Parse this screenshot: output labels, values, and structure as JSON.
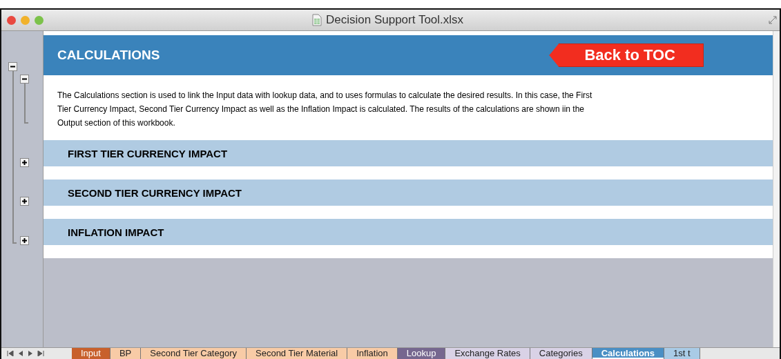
{
  "window": {
    "title": "Decision Support Tool.xlsx"
  },
  "header": {
    "title": "CALCULATIONS",
    "button": "Back to TOC"
  },
  "description": "The Calculations section is used to link the Input data with lookup data, and to uses formulas to calculate the desired results. In this case, the First Tier Currency Impact, Second Tier Currency Impact as well as the Inflation Impact is calculated. The results of the calculations are shown iin the Output section of this workbook.",
  "outline": {
    "expanded": true,
    "groups": [
      {
        "expanded": true
      },
      {
        "expanded": false
      },
      {
        "expanded": false
      },
      {
        "expanded": false
      }
    ]
  },
  "sections": [
    {
      "title": "FIRST TIER CURRENCY IMPACT"
    },
    {
      "title": "SECOND TIER CURRENCY IMPACT"
    },
    {
      "title": "INFLATION IMPACT"
    }
  ],
  "sheet_tabs": [
    {
      "label": "Input",
      "color": "#c8602c",
      "selected": false
    },
    {
      "label": "BP",
      "color": "#f8cba6",
      "selected": false
    },
    {
      "label": "Second Tier Category",
      "color": "#f8cba6",
      "selected": false
    },
    {
      "label": "Second Tier Material",
      "color": "#f8cba6",
      "selected": false
    },
    {
      "label": "Inflation",
      "color": "#f8cba6",
      "selected": false
    },
    {
      "label": "Lookup",
      "color": "#76678f",
      "selected": false
    },
    {
      "label": "Exchange Rates",
      "color": "#d9d2e6",
      "selected": false
    },
    {
      "label": "Categories",
      "color": "#d9d2e6",
      "selected": false
    },
    {
      "label": "Calculations",
      "color": "#4a8fc4",
      "selected": true
    },
    {
      "label": "1st t",
      "color": "#a9cbe6",
      "selected": false
    }
  ]
}
